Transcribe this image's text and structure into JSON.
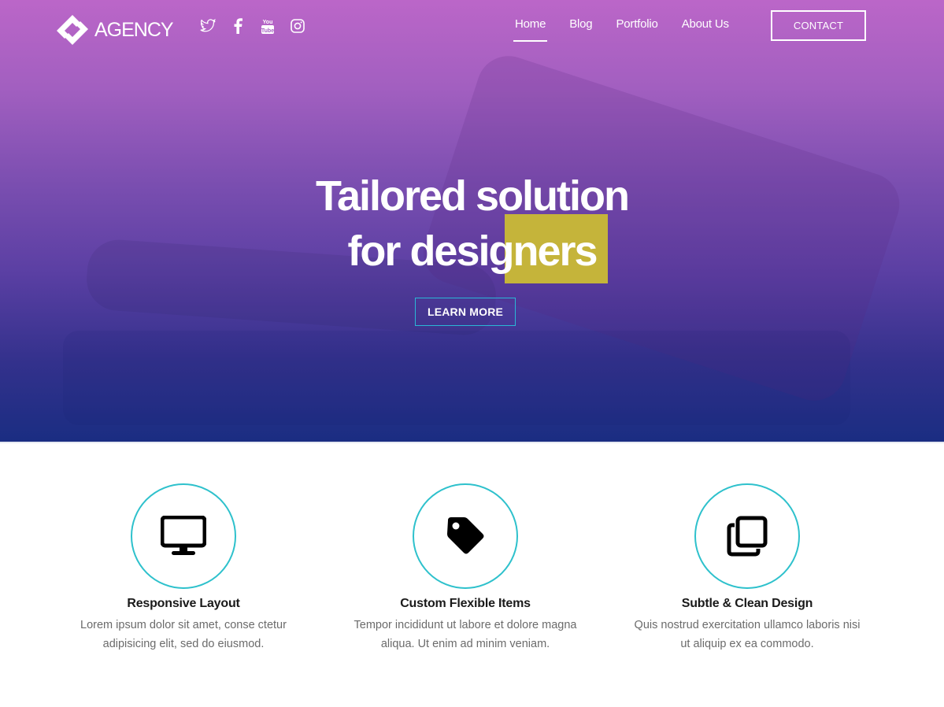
{
  "header": {
    "logo_text": "AGENCY",
    "social": [
      {
        "name": "twitter-icon"
      },
      {
        "name": "facebook-icon"
      },
      {
        "name": "youtube-icon"
      },
      {
        "name": "instagram-icon"
      }
    ],
    "nav": [
      {
        "label": "Home",
        "active": true
      },
      {
        "label": "Blog",
        "active": false
      },
      {
        "label": "Portfolio",
        "active": false
      },
      {
        "label": "About Us",
        "active": false
      }
    ],
    "contact_label": "CONTACT"
  },
  "hero": {
    "title_line1": "Tailored solution",
    "title_line2": "for designers",
    "cta_label": "LEARN MORE",
    "highlight_color": "#c5b43a",
    "accent_color": "#2ab7d6"
  },
  "features": [
    {
      "icon": "monitor-icon",
      "title": "Responsive Layout",
      "desc_line1": "Lorem ipsum dolor sit amet, conse ctetur",
      "desc_line2": "adipisicing elit, sed do eiusmod."
    },
    {
      "icon": "tag-icon",
      "title": "Custom Flexible Items",
      "desc_line1": "Tempor incididunt ut labore et dolore magna",
      "desc_line2": "aliqua. Ut enim ad minim veniam."
    },
    {
      "icon": "copy-icon",
      "title": "Subtle & Clean Design",
      "desc_line1": "Quis nostrud exercitation ullamco laboris nisi",
      "desc_line2": "ut aliquip ex ea commodo."
    }
  ]
}
